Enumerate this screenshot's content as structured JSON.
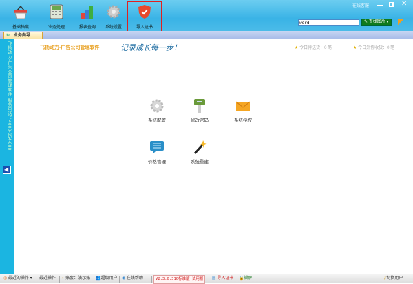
{
  "window": {
    "online_service": "在线客服"
  },
  "toolbar": {
    "items": [
      {
        "label": "基础档案",
        "icon": "basket-icon"
      },
      {
        "label": "业务处理",
        "icon": "calculator-icon"
      },
      {
        "label": "报表查询",
        "icon": "bar-chart-icon"
      },
      {
        "label": "系统设置",
        "icon": "gear-icon"
      },
      {
        "label": "导入证书",
        "icon": "shield-icon"
      }
    ],
    "search_value": "word",
    "search_button": "查找图片"
  },
  "tabs": [
    {
      "label": "业务向导"
    }
  ],
  "sidebar": {
    "text": "飞扬动力-广告公司管理软件 服务电话：4008-654-888"
  },
  "main": {
    "brand": "飞扬动力-广告公司管理软件",
    "slogan": "记录成长每一步！",
    "stats": [
      "今日待送货：0 笔",
      "今日外协收货：0 笔"
    ],
    "apps": [
      {
        "label": "系统配置",
        "icon": "gear-icon"
      },
      {
        "label": "修改密码",
        "icon": "key-icon"
      },
      {
        "label": "系统授权",
        "icon": "envelope-icon"
      },
      {
        "label": "价格管理",
        "icon": "chat-bubble-icon"
      },
      {
        "label": "系统重建",
        "icon": "magic-wand-icon"
      }
    ]
  },
  "status": {
    "recent_ops": "最近的操作",
    "recent": "最近操作",
    "account": "账套：演示账",
    "user": "超级用户",
    "help": "在线帮助",
    "version": "V2.3.0.310标准版 试用版",
    "import_cert": "导入证书",
    "lock": "锁屏",
    "switch_user": "切换用户"
  },
  "colors": {
    "toolbar": "#39b3e6",
    "sidebar": "#1bb5e1",
    "highlight": "#e02020",
    "version_text": "#d02020"
  }
}
